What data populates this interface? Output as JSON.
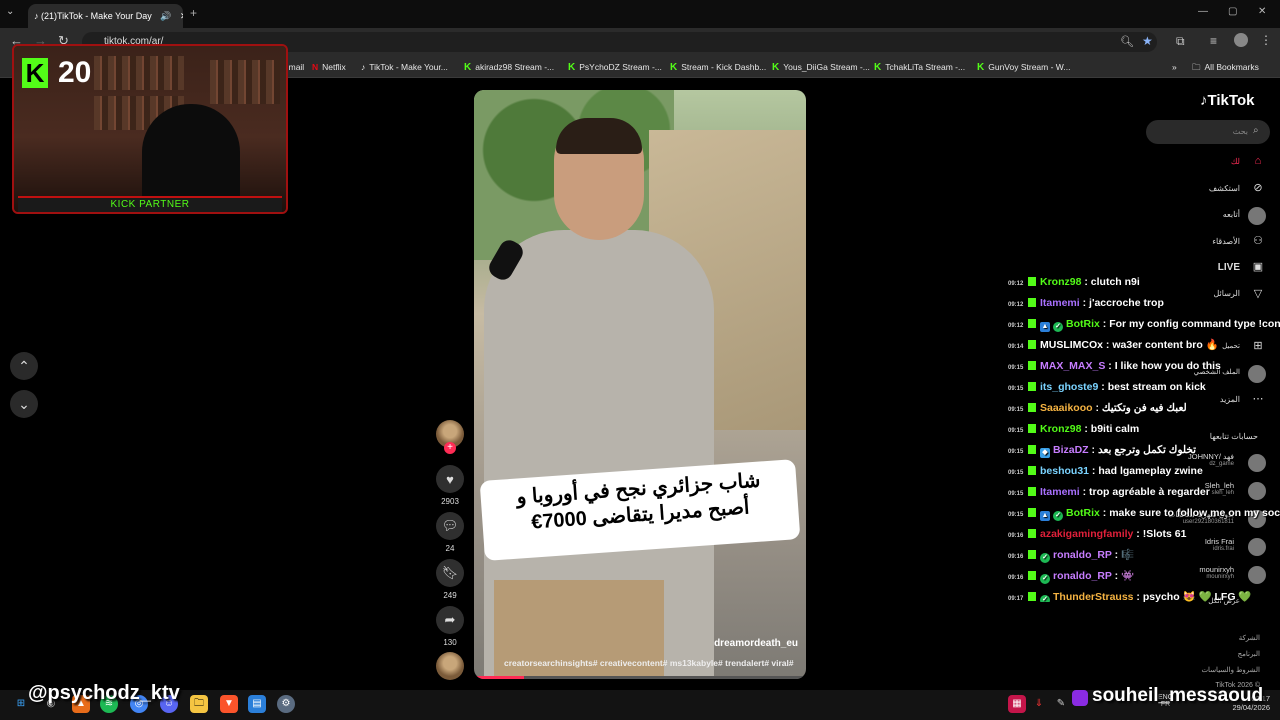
{
  "browser": {
    "tab_title": "(21)TikTok - Make Your Day",
    "url": "tiktok.com/ar/",
    "bookmarks": [
      {
        "label": "Gmail",
        "icon": "gmail-icon"
      },
      {
        "label": "Netflix",
        "icon": "netflix-icon"
      },
      {
        "label": "TikTok - Make Your...",
        "icon": "tiktok-icon"
      },
      {
        "label": "akiradz98 Stream -...",
        "icon": "kick-icon"
      },
      {
        "label": "PsYchoDZ Stream -...",
        "icon": "kick-icon"
      },
      {
        "label": "Stream - Kick Dashb...",
        "icon": "kick-icon"
      },
      {
        "label": "Yous_DiiGa Stream -...",
        "icon": "kick-icon"
      },
      {
        "label": "TchakLiTa Stream -...",
        "icon": "kick-icon"
      },
      {
        "label": "GunVoy Stream - W...",
        "icon": "kick-icon"
      }
    ],
    "all_bookmarks": "All Bookmarks"
  },
  "webcam": {
    "kick_count": "20",
    "partner_label": "KICK PARTNER"
  },
  "video": {
    "caption_line1": "شاب جزائري نجح في أوروبا و",
    "caption_line2": "أصبح مديرا يتقاضى 7000€",
    "username": "dreamordeath_eu",
    "hashtags": "creatorsearchinsights# creativecontent# ms13kabyle# trendalert# viral#",
    "progress": 0.15,
    "likes": "2903",
    "comments": "24",
    "bookmarks": "249",
    "shares": "130"
  },
  "tiktok_sidebar": {
    "logo": "TikTok",
    "search_placeholder": "بحث",
    "items": [
      {
        "label": "لك",
        "icon": "home-icon"
      },
      {
        "label": "استكشف",
        "icon": "compass-icon"
      },
      {
        "label": "أتابعه",
        "icon": "following-icon"
      },
      {
        "label": "الأصدقاء",
        "icon": "friends-icon"
      },
      {
        "label": "LIVE",
        "icon": "live-icon"
      },
      {
        "label": "الرسائل",
        "icon": "messages-icon"
      },
      {
        "label": "تحميل",
        "icon": "upload-icon"
      },
      {
        "label": "الملف الشخصي",
        "icon": "profile-icon"
      },
      {
        "label": "المزيد",
        "icon": "more-icon"
      }
    ],
    "following_header": "حسابات تتابعها",
    "following": [
      {
        "name": "JOHNNY/ فهد",
        "handle": "dz_game"
      },
      {
        "name": "Sleh_leh",
        "handle": "sleh_leh"
      },
      {
        "name": "بدون شهرية مكالمات",
        "handle": "user292180361811"
      },
      {
        "name": "Idris Frai",
        "handle": "idris.frai"
      },
      {
        "name": "mounirxyh",
        "handle": "mounirxyh"
      }
    ],
    "see_more": "عرض الكل",
    "footer": [
      "الشركة",
      "البرنامج",
      "الشروط والسياسات",
      "TikTok 2026 ©"
    ]
  },
  "chat": [
    {
      "time": "09:12",
      "user": "Kronz98",
      "color": "#53fc18",
      "badges": [],
      "msg": "clutch n9i"
    },
    {
      "time": "09:12",
      "user": "Itamemi",
      "color": "#a970ff",
      "badges": [],
      "msg": "j'accroche trop"
    },
    {
      "time": "09:12",
      "user": "BotRix",
      "color": "#53fc18",
      "badges": [
        "bot",
        "verified"
      ],
      "msg": "For my config command type !con"
    },
    {
      "time": "09:14",
      "user": "MUSLIMCOx",
      "color": "#ffffff",
      "badges": [],
      "msg": "wa3er content bro 🔥"
    },
    {
      "time": "09:15",
      "user": "MAX_MAX_S",
      "color": "#c77dff",
      "badges": [],
      "msg": "I like how you do this"
    },
    {
      "time": "09:15",
      "user": "its_ghoste9",
      "color": "#7ad3ff",
      "badges": [],
      "msg": "best stream on kick"
    },
    {
      "time": "09:15",
      "user": "Saaaikooo",
      "color": "#f5b342",
      "badges": [],
      "msg": "لعبك فيه فن وتكتيك"
    },
    {
      "time": "09:15",
      "user": "Kronz98",
      "color": "#53fc18",
      "badges": [],
      "msg": "b9iti calm"
    },
    {
      "time": "09:15",
      "user": "BizaDZ",
      "color": "#c77dff",
      "badges": [
        "gem"
      ],
      "msg": "تخلوك تكمل وترجع بعد"
    },
    {
      "time": "09:15",
      "user": "beshou31",
      "color": "#7ad3ff",
      "badges": [],
      "msg": "had lgameplay zwine"
    },
    {
      "time": "09:15",
      "user": "Itamemi",
      "color": "#a970ff",
      "badges": [],
      "msg": "trop agréable à regarder"
    },
    {
      "time": "09:15",
      "user": "BotRix",
      "color": "#53fc18",
      "badges": [
        "bot",
        "verified"
      ],
      "msg": "make sure to follow me on my soc"
    },
    {
      "time": "09:16",
      "user": "azakigamingfamily",
      "color": "#e0203a",
      "badges": [],
      "msg": "!Slots 61"
    },
    {
      "time": "09:16",
      "user": "ronaldo_RP",
      "color": "#c77dff",
      "badges": [
        "verified"
      ],
      "msg": "🎼"
    },
    {
      "time": "09:16",
      "user": "ronaldo_RP",
      "color": "#c77dff",
      "badges": [
        "verified"
      ],
      "msg": "👾"
    },
    {
      "time": "09:17",
      "user": "ThunderStrauss",
      "color": "#f5b342",
      "badges": [
        "verified"
      ],
      "msg": "psycho 😻 💚 LFG 💚"
    }
  ],
  "overlay": {
    "left_handle": "@psychodz_ktv",
    "right_name": "souheil_messaoud"
  },
  "taskbar": {
    "lang": "ENG",
    "lang2": "FR",
    "time": "09:17",
    "date": "29/04/2026"
  },
  "colors": {
    "kick_green": "#53fc18",
    "tiktok_red": "#fe2c55",
    "frame_red": "#a01010"
  }
}
